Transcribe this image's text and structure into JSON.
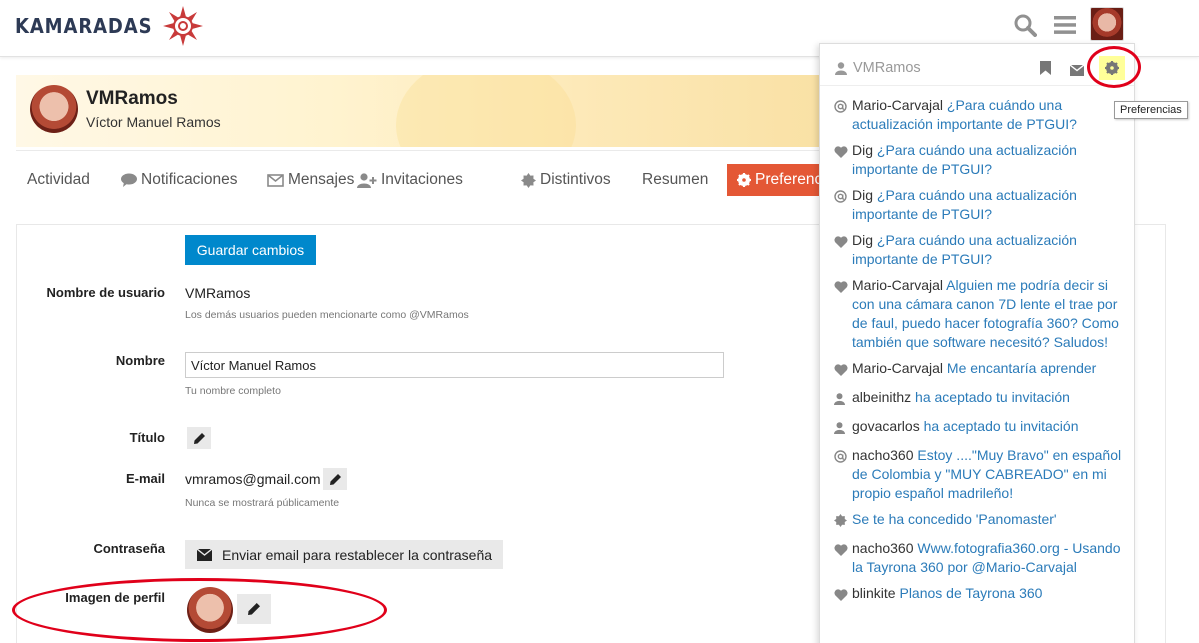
{
  "header": {
    "logo_text": "KAMARADAS",
    "search_icon": "search-icon",
    "menu_icon": "hamburger-icon"
  },
  "profile": {
    "username": "VMRamos",
    "full_name": "Víctor Manuel Ramos"
  },
  "nav": {
    "items": [
      {
        "label": "Actividad",
        "icon": ""
      },
      {
        "label": "Notificaciones",
        "icon": "comment-icon"
      },
      {
        "label": "Mensajes",
        "icon": "envelope-icon"
      },
      {
        "label": "Invitaciones",
        "icon": "user-plus-icon"
      },
      {
        "label": "Distintivos",
        "icon": "badge-icon"
      },
      {
        "label": "Resumen",
        "icon": ""
      },
      {
        "label": "Preferencias",
        "icon": "gear-icon"
      }
    ]
  },
  "form": {
    "save_label": "Guardar cambios",
    "username_label": "Nombre de usuario",
    "username_value": "VMRamos",
    "username_hint": "Los demás usuarios pueden mencionarte como @VMRamos",
    "name_label": "Nombre",
    "name_value": "Víctor Manuel Ramos",
    "name_hint": "Tu nombre completo",
    "title_label": "Título",
    "email_label": "E-mail",
    "email_value": "vmramos@gmail.com",
    "email_hint": "Nunca se mostrará públicamente",
    "password_label": "Contraseña",
    "password_button": "Enviar email para restablecer la contraseña",
    "avatar_label": "Imagen de perfil"
  },
  "user_menu": {
    "username": "VMRamos",
    "tooltip": "Preferencias",
    "notifications": [
      {
        "icon": "at-icon",
        "who": "Mario-Carvajal",
        "what": "¿Para cuándo una actualización importante de PTGUI?"
      },
      {
        "icon": "heart-icon",
        "who": "Dig",
        "what": "¿Para cuándo una actualización importante de PTGUI?"
      },
      {
        "icon": "at-icon",
        "who": "Dig",
        "what": "¿Para cuándo una actualización importante de PTGUI?"
      },
      {
        "icon": "heart-icon",
        "who": "Dig",
        "what": "¿Para cuándo una actualización importante de PTGUI?"
      },
      {
        "icon": "heart-icon",
        "who": "Mario-Carvajal",
        "what": "Alguien me podría decir si con una cámara canon 7D lente el trae por de faul, puedo hacer fotografía 360? Como también que software necesitó? Saludos!"
      },
      {
        "icon": "heart-icon",
        "who": "Mario-Carvajal",
        "what": "Me encantaría aprender"
      },
      {
        "icon": "user-icon",
        "who": "albeinithz",
        "what": "ha aceptado tu invitación"
      },
      {
        "icon": "user-icon",
        "who": "govacarlos",
        "what": "ha aceptado tu invitación"
      },
      {
        "icon": "at-icon",
        "who": "nacho360",
        "what": "Estoy ....\"Muy Bravo\" en español de Colombia y \"MUY CABREADO\" en mi propio español madrileño!"
      },
      {
        "icon": "badge-icon",
        "who": "",
        "what": "Se te ha concedido 'Panomaster'"
      },
      {
        "icon": "heart-icon",
        "who": "nacho360",
        "what": "Www.fotografia360.org - Usando la Tayrona 360 por @Mario-Carvajal"
      },
      {
        "icon": "heart-icon",
        "who": "blinkite",
        "what": "Planos de Tayrona 360"
      }
    ]
  },
  "colors": {
    "accent": "#e45735",
    "primary_button": "#0088cc",
    "link": "#2b7bb9",
    "highlight_ring": "#e0001a"
  }
}
